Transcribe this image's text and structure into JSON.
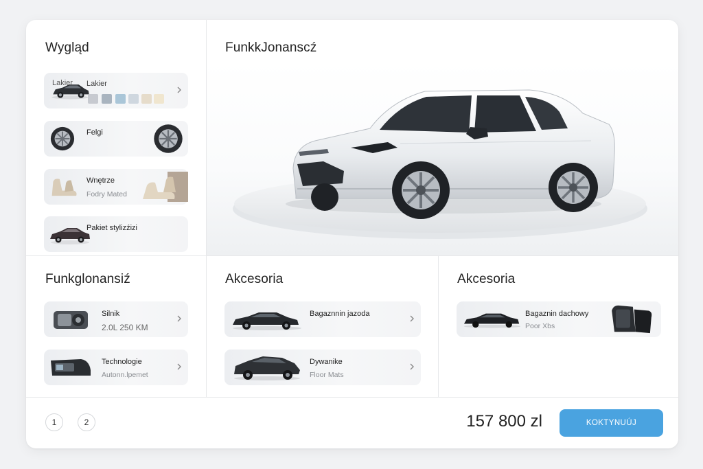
{
  "panels": {
    "wyglad": {
      "title": "Wygląd",
      "items": [
        {
          "label": "Lakier",
          "sub": "Lakier"
        },
        {
          "label": "Felgi",
          "sub": ""
        },
        {
          "label": "Wnętrze",
          "sub": "Fodry Mated"
        },
        {
          "label": "Pakiet stylizźizi",
          "sub": ""
        }
      ],
      "swatches": [
        "#c7cad0",
        "#a9b4bf",
        "#aac6d8",
        "#cfd7df",
        "#e6dccb",
        "#f0e6cf"
      ]
    },
    "hero": {
      "title": "FunkkJonanscź"
    },
    "funkcjonalnosc": {
      "title": "Funkglonansiź",
      "items": [
        {
          "label": "Silnik",
          "sub": "2.0L 250 KM"
        },
        {
          "label": "Technologie",
          "sub": "Autonn.lpemet"
        }
      ]
    },
    "akcesoria_1": {
      "title": "Akcesoria",
      "items": [
        {
          "label": "Bagaznnin jazoda",
          "sub": ""
        },
        {
          "label": "Dywanike",
          "sub": "Floor Mats"
        }
      ]
    },
    "akcesoria_2": {
      "title": "Akcesoria",
      "items": [
        {
          "label": "Bagaznin dachowy",
          "sub": "Poor Xbs"
        }
      ]
    }
  },
  "footer": {
    "page_1": "1",
    "page_2": "2",
    "price": "157 800 zl",
    "cta_label": "KOKTYNUÚJ"
  },
  "colors": {
    "accent": "#4aa3e0",
    "car_body": "#eef0f3"
  },
  "icons": [
    "chevron-right-icon",
    "car-thumbnail",
    "wheel-thumbnail",
    "seat-thumbnail",
    "engine-thumbnail",
    "roof-box-thumbnail"
  ]
}
